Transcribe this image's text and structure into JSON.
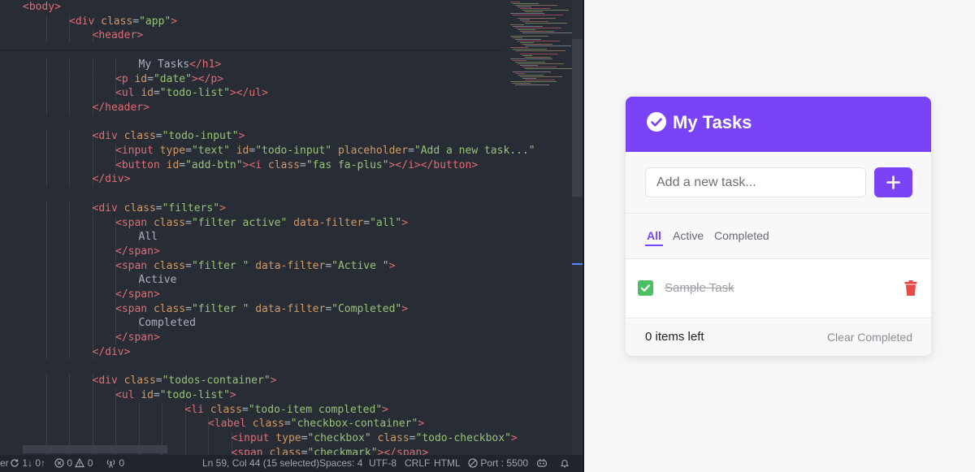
{
  "editor": {
    "lines": [
      {
        "indent": 1,
        "tokens": [
          [
            "tag",
            "<body>"
          ]
        ]
      },
      {
        "indent": 3,
        "tokens": [
          [
            "tag",
            "<div "
          ],
          [
            "attr",
            "class"
          ],
          [
            "eq",
            "="
          ],
          [
            "str",
            "\"app\""
          ],
          [
            "tag",
            ">"
          ]
        ]
      },
      {
        "indent": 4,
        "tokens": [
          [
            "tag",
            "<header>"
          ]
        ]
      },
      {
        "indent": 0,
        "tokens": []
      },
      {
        "indent": 6,
        "tokens": [
          [
            "txt",
            "My Tasks"
          ],
          [
            "tag",
            "</h1>"
          ]
        ]
      },
      {
        "indent": 5,
        "tokens": [
          [
            "tag",
            "<p "
          ],
          [
            "attr",
            "id"
          ],
          [
            "eq",
            "="
          ],
          [
            "str",
            "\"date\""
          ],
          [
            "tag",
            "></p>"
          ]
        ]
      },
      {
        "indent": 5,
        "tokens": [
          [
            "tag",
            "<ul "
          ],
          [
            "attr",
            "id"
          ],
          [
            "eq",
            "="
          ],
          [
            "str",
            "\"todo-list\""
          ],
          [
            "tag",
            "></ul>"
          ]
        ]
      },
      {
        "indent": 4,
        "tokens": [
          [
            "tag",
            "</header>"
          ]
        ]
      },
      {
        "indent": 0,
        "tokens": []
      },
      {
        "indent": 4,
        "tokens": [
          [
            "tag",
            "<div "
          ],
          [
            "attr",
            "class"
          ],
          [
            "eq",
            "="
          ],
          [
            "str",
            "\"todo-input\""
          ],
          [
            "tag",
            ">"
          ]
        ]
      },
      {
        "indent": 5,
        "tokens": [
          [
            "tag",
            "<input "
          ],
          [
            "attr",
            "type"
          ],
          [
            "eq",
            "="
          ],
          [
            "str",
            "\"text\" "
          ],
          [
            "attr",
            "id"
          ],
          [
            "eq",
            "="
          ],
          [
            "str",
            "\"todo-input\" "
          ],
          [
            "attr",
            "placeholder"
          ],
          [
            "eq",
            "="
          ],
          [
            "str",
            "\"Add a new task...\""
          ]
        ]
      },
      {
        "indent": 5,
        "tokens": [
          [
            "tag",
            "<button "
          ],
          [
            "attr",
            "id"
          ],
          [
            "eq",
            "="
          ],
          [
            "str",
            "\"add-btn\""
          ],
          [
            "tag",
            "><i "
          ],
          [
            "attr",
            "class"
          ],
          [
            "eq",
            "="
          ],
          [
            "str",
            "\"fas fa-plus\""
          ],
          [
            "tag",
            "></i></button>"
          ]
        ]
      },
      {
        "indent": 4,
        "tokens": [
          [
            "tag",
            "</div>"
          ]
        ]
      },
      {
        "indent": 0,
        "tokens": []
      },
      {
        "indent": 4,
        "tokens": [
          [
            "tag",
            "<div "
          ],
          [
            "attr",
            "class"
          ],
          [
            "eq",
            "="
          ],
          [
            "str",
            "\"filters\""
          ],
          [
            "tag",
            ">"
          ]
        ]
      },
      {
        "indent": 5,
        "tokens": [
          [
            "tag",
            "<span "
          ],
          [
            "attr",
            "class"
          ],
          [
            "eq",
            "="
          ],
          [
            "str",
            "\"filter active\" "
          ],
          [
            "attr",
            "data-filter"
          ],
          [
            "eq",
            "="
          ],
          [
            "str",
            "\"all\""
          ],
          [
            "tag",
            ">"
          ]
        ]
      },
      {
        "indent": 6,
        "tokens": [
          [
            "txt",
            "All"
          ]
        ]
      },
      {
        "indent": 5,
        "tokens": [
          [
            "tag",
            "</span>"
          ]
        ]
      },
      {
        "indent": 5,
        "tokens": [
          [
            "tag",
            "<span "
          ],
          [
            "attr",
            "class"
          ],
          [
            "eq",
            "="
          ],
          [
            "str",
            "\"filter \" "
          ],
          [
            "attr",
            "data-filter"
          ],
          [
            "eq",
            "="
          ],
          [
            "str",
            "\"Active \""
          ],
          [
            "tag",
            ">"
          ]
        ]
      },
      {
        "indent": 6,
        "tokens": [
          [
            "txt",
            "Active"
          ]
        ]
      },
      {
        "indent": 5,
        "tokens": [
          [
            "tag",
            "</span>"
          ]
        ]
      },
      {
        "indent": 5,
        "tokens": [
          [
            "tag",
            "<span "
          ],
          [
            "attr",
            "class"
          ],
          [
            "eq",
            "="
          ],
          [
            "str",
            "\"filter \" "
          ],
          [
            "attr",
            "data-filter"
          ],
          [
            "eq",
            "="
          ],
          [
            "str",
            "\"Completed\""
          ],
          [
            "tag",
            ">"
          ]
        ]
      },
      {
        "indent": 6,
        "tokens": [
          [
            "txt",
            "Completed"
          ]
        ]
      },
      {
        "indent": 5,
        "tokens": [
          [
            "tag",
            "</span>"
          ]
        ]
      },
      {
        "indent": 4,
        "tokens": [
          [
            "tag",
            "</div>"
          ]
        ]
      },
      {
        "indent": 0,
        "tokens": []
      },
      {
        "indent": 4,
        "tokens": [
          [
            "tag",
            "<div "
          ],
          [
            "attr",
            "class"
          ],
          [
            "eq",
            "="
          ],
          [
            "str",
            "\"todos-container\""
          ],
          [
            "tag",
            ">"
          ]
        ]
      },
      {
        "indent": 5,
        "tokens": [
          [
            "tag",
            "<ul "
          ],
          [
            "attr",
            "id"
          ],
          [
            "eq",
            "="
          ],
          [
            "str",
            "\"todo-list\""
          ],
          [
            "tag",
            ">"
          ]
        ]
      },
      {
        "indent": 8,
        "tokens": [
          [
            "tag",
            "<li "
          ],
          [
            "attr",
            "class"
          ],
          [
            "eq",
            "="
          ],
          [
            "str",
            "\"todo-item completed\""
          ],
          [
            "tag",
            ">"
          ]
        ]
      },
      {
        "indent": 9,
        "tokens": [
          [
            "tag",
            "<label "
          ],
          [
            "attr",
            "class"
          ],
          [
            "eq",
            "="
          ],
          [
            "str",
            "\"checkbox-container\""
          ],
          [
            "tag",
            ">"
          ]
        ]
      },
      {
        "indent": 10,
        "tokens": [
          [
            "tag",
            "<input "
          ],
          [
            "attr",
            "type"
          ],
          [
            "eq",
            "="
          ],
          [
            "str",
            "\"checkbox\" "
          ],
          [
            "attr",
            "class"
          ],
          [
            "eq",
            "="
          ],
          [
            "str",
            "\"todo-checkbox\""
          ],
          [
            "tag",
            ">"
          ]
        ]
      },
      {
        "indent": 10,
        "tokens": [
          [
            "tag",
            "<span "
          ],
          [
            "attr",
            "class"
          ],
          [
            "eq",
            "="
          ],
          [
            "str",
            "\"checkmark\""
          ],
          [
            "tag",
            "></span>"
          ]
        ]
      }
    ],
    "line_numbers": [
      "",
      "",
      "",
      "",
      "",
      "",
      "",
      "",
      "",
      "",
      "",
      "",
      "",
      "",
      "",
      "",
      "",
      "",
      "",
      "",
      "",
      "",
      "",
      "",
      "",
      "",
      "",
      "",
      "",
      "",
      "",
      ""
    ]
  },
  "statusbar": {
    "left_fragment": "er",
    "sync": "1↓ 0↑",
    "errors": "0",
    "warnings": "0",
    "ports": "0",
    "position": "Ln 59, Col 44 (15 selected)",
    "spaces": "Spaces: 4",
    "encoding": "UTF-8",
    "eol": "CRLF",
    "language": "HTML",
    "port": "Port : 5500"
  },
  "app": {
    "title": "My Tasks",
    "input_placeholder": "Add a new task...",
    "add_button_symbol": "+",
    "filters": [
      {
        "label": "All",
        "active": true
      },
      {
        "label": "Active",
        "active": false
      },
      {
        "label": "Completed",
        "active": false
      }
    ],
    "todos": [
      {
        "text": "Sample Task",
        "completed": true
      }
    ],
    "items_left": "0 items left",
    "clear_completed": "Clear Completed",
    "colors": {
      "accent": "#7a43f5",
      "check": "#4bbf63",
      "delete": "#e84a4a"
    }
  }
}
